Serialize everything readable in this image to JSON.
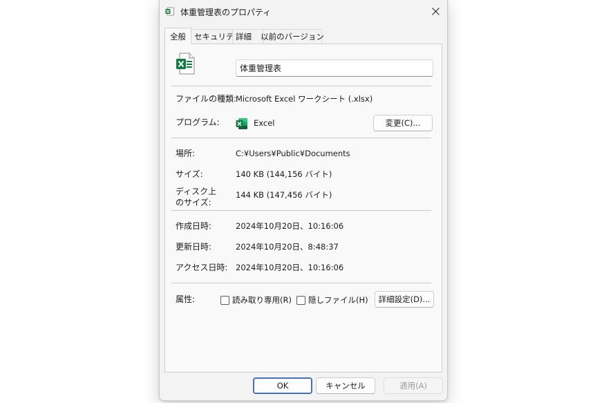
{
  "window": {
    "title": "体重管理表のプロパティ"
  },
  "tabs": [
    {
      "label": "全般"
    },
    {
      "label": "セキュリティ"
    },
    {
      "label": "詳細"
    },
    {
      "label": "以前のバージョン"
    }
  ],
  "general": {
    "file_name": "体重管理表",
    "file_type_label": "ファイルの種類:",
    "file_type_value": "Microsoft Excel ワークシート (.xlsx)",
    "program_label": "プログラム:",
    "program_name": "Excel",
    "change_button": "変更(C)...",
    "location_label": "場所:",
    "location_value": "C:¥Users¥Public¥Documents",
    "size_label": "サイズ:",
    "size_value": "140 KB (144,156 バイト)",
    "size_on_disk_label_line1": "ディスク上",
    "size_on_disk_label_line2": "のサイズ:",
    "size_on_disk_value": "144 KB (147,456 バイト)",
    "created_label": "作成日時:",
    "created_value": "2024年10月20日、10:16:06",
    "modified_label": "更新日時:",
    "modified_value": "2024年10月20日、8:48:37",
    "accessed_label": "アクセス日時:",
    "accessed_value": "2024年10月20日、10:16:06",
    "attributes_label": "属性:",
    "readonly_label": "読み取り専用(R)",
    "hidden_label": "隠しファイル(H)",
    "advanced_button": "詳細設定(D)..."
  },
  "footer": {
    "ok": "OK",
    "cancel": "キャンセル",
    "apply": "適用(A)"
  },
  "colors": {
    "excel_green": "#107c41",
    "accent": "#4a6fb5"
  }
}
